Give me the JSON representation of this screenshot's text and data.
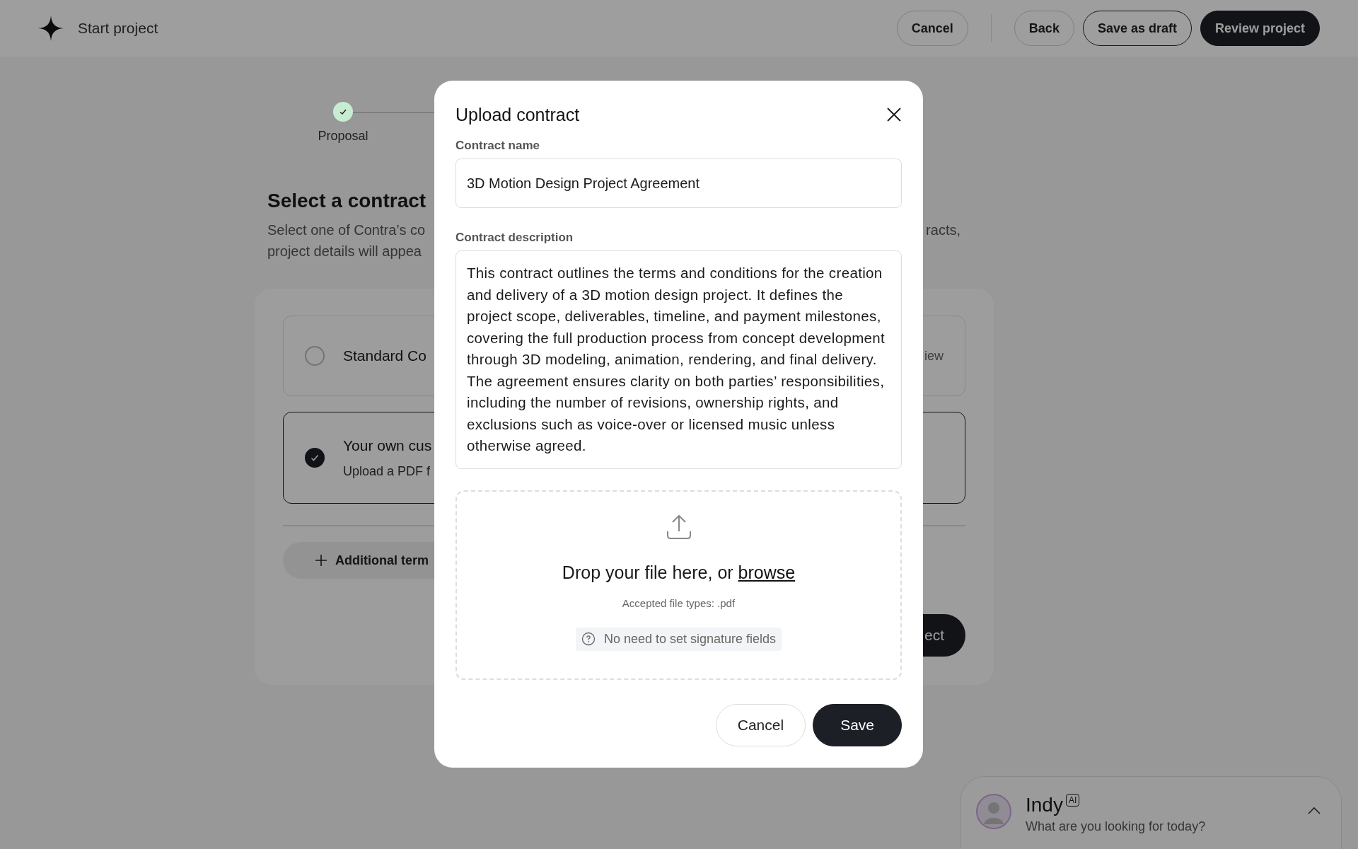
{
  "header": {
    "title": "Start project",
    "exit_button": {
      "label": "Cancel"
    },
    "nav_buttons": [
      {
        "label": "Back",
        "kind": "outline"
      },
      {
        "label": "Save as draft",
        "kind": "outline-strong"
      },
      {
        "label": "Review project",
        "kind": "primary"
      }
    ]
  },
  "stepper": {
    "steps": [
      {
        "label": "Proposal",
        "done": true
      }
    ]
  },
  "page": {
    "title": "Select a contract",
    "description_left": [
      "Select one of Contra’s co",
      "project details will appea"
    ],
    "description_right": [
      "racts,"
    ]
  },
  "contracts": [
    {
      "title": "Standard Co",
      "action": "iew",
      "selected": false
    },
    {
      "title": "Your own cus",
      "subtitle": "Upload a PDF f",
      "selected": true
    }
  ],
  "additional_terms": {
    "label": "Additional term"
  },
  "next_button": {
    "label": "ect"
  },
  "modal": {
    "title": "Upload contract",
    "fields": [
      {
        "label": "Contract name",
        "value": "3D Motion Design Project Agreement",
        "kind": "input"
      },
      {
        "label": "Contract description",
        "value": "This contract outlines the terms and conditions for the creation and delivery of a 3D motion design project. It defines the project scope, deliverables, timeline, and payment milestones, covering the full production process from concept development through 3D modeling, animation, rendering, and final delivery. The agreement ensures clarity on both parties’ responsibilities, including the number of revisions, ownership rights, and exclusions such as voice-over or licensed music unless otherwise agreed.",
        "kind": "textarea"
      }
    ],
    "dropzone": {
      "text": "Drop your file here, or ",
      "link": "browse",
      "hint": "Accepted file types: .pdf",
      "note": "No need to set signature fields"
    },
    "buttons": [
      {
        "label": "Cancel",
        "kind": "secondary"
      },
      {
        "label": "Save",
        "kind": "primary"
      }
    ]
  },
  "assistant": {
    "name": "Indy",
    "badge": "AI",
    "prompt": "What are you looking for today?"
  }
}
